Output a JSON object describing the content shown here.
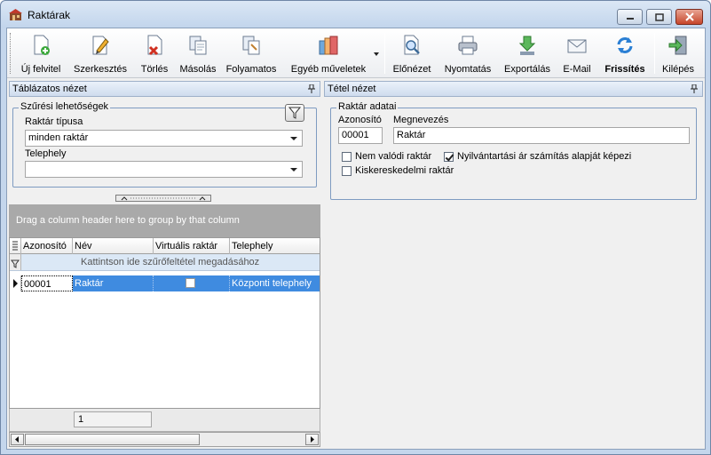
{
  "window": {
    "title": "Raktárak"
  },
  "toolbar": {
    "buttons": [
      {
        "label": "Új felvitel",
        "icon": "new-doc-icon"
      },
      {
        "label": "Szerkesztés",
        "icon": "edit-icon"
      },
      {
        "label": "Törlés",
        "icon": "delete-icon"
      },
      {
        "label": "Másolás",
        "icon": "copy-icon"
      },
      {
        "label": "Folyamatos",
        "icon": "continuous-icon"
      },
      {
        "label": "Egyéb műveletek",
        "icon": "other-actions-icon"
      },
      {
        "label": "Előnézet",
        "icon": "preview-icon"
      },
      {
        "label": "Nyomtatás",
        "icon": "print-icon"
      },
      {
        "label": "Exportálás",
        "icon": "export-icon"
      },
      {
        "label": "E-Mail",
        "icon": "email-icon"
      },
      {
        "label": "Frissítés",
        "icon": "refresh-icon"
      },
      {
        "label": "Kilépés",
        "icon": "exit-icon"
      }
    ]
  },
  "left_panel": {
    "title": "Táblázatos nézet",
    "filter": {
      "legend": "Szűrési lehetőségek",
      "type_label": "Raktár típusa",
      "type_value": "minden raktár",
      "site_label": "Telephely",
      "site_value": ""
    },
    "groupbar_text": "Drag a column header here to group by that column",
    "grid": {
      "columns": [
        "Azonosító",
        "Név",
        "Virtuális raktár",
        "Telephely"
      ],
      "filter_row_text": "Kattintson ide szűrőfeltétel megadásához",
      "rows": [
        {
          "id": "00001",
          "name": "Raktár",
          "virtual": false,
          "site": "Központi telephely"
        }
      ],
      "footer_count": "1"
    }
  },
  "right_panel": {
    "title": "Tétel nézet",
    "group_legend": "Raktár adatai",
    "id_label": "Azonosító",
    "id_value": "00001",
    "name_label": "Megnevezés",
    "name_value": "Raktár",
    "checkboxes": [
      {
        "label": "Nem valódi raktár",
        "checked": false
      },
      {
        "label": "Nyilvántartási ár számítás alapját képezi",
        "checked": true
      },
      {
        "label": "Kiskereskedelmi raktár",
        "checked": false
      }
    ]
  },
  "colors": {
    "selected_row": "#3f8be0",
    "panel_header": "#cfdcee",
    "group_border": "#7e9bc1"
  }
}
